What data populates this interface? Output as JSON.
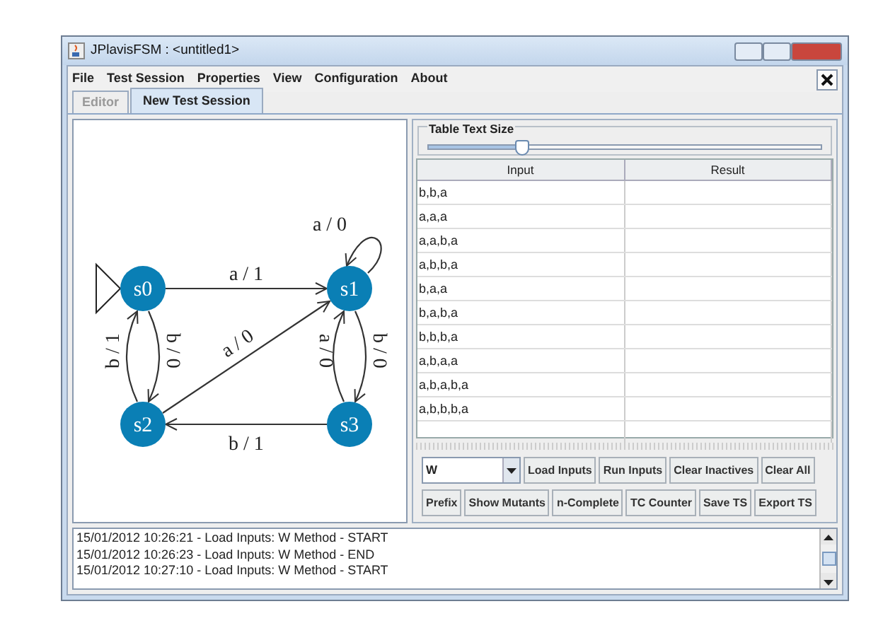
{
  "window": {
    "title": "JPlavisFSM : <untitled1>"
  },
  "menu": [
    "File",
    "Test Session",
    "Properties",
    "View",
    "Configuration",
    "About"
  ],
  "tabs": [
    {
      "label": "Editor",
      "selected": false
    },
    {
      "label": "New Test Session",
      "selected": true
    }
  ],
  "fsm": {
    "states": [
      {
        "name": "s0",
        "initial": true
      },
      {
        "name": "s1",
        "initial": false
      },
      {
        "name": "s2",
        "initial": false
      },
      {
        "name": "s3",
        "initial": false
      }
    ],
    "transitions": [
      {
        "label": "a / 1"
      },
      {
        "label": "a / 0"
      },
      {
        "label": "b / 0"
      },
      {
        "label": "b / 1"
      },
      {
        "label": "a / 0"
      },
      {
        "label": "b / 0"
      },
      {
        "label": "a / 0"
      },
      {
        "label": "b / 1"
      }
    ]
  },
  "table_text_size": {
    "label": "Table Text Size",
    "level": 0.24
  },
  "table": {
    "columns": [
      "Input",
      "Result"
    ],
    "rows": [
      {
        "input": "b,b,a"
      },
      {
        "input": "a,a,a"
      },
      {
        "input": "a,a,b,a"
      },
      {
        "input": "a,b,b,a"
      },
      {
        "input": "b,a,a"
      },
      {
        "input": "b,a,b,a"
      },
      {
        "input": "b,b,b,a"
      },
      {
        "input": "a,b,a,a"
      },
      {
        "input": "a,b,a,b,a"
      },
      {
        "input": "a,b,b,b,a"
      }
    ]
  },
  "method_select": {
    "value": "W"
  },
  "buttons_row1": [
    "Load Inputs",
    "Run Inputs",
    "Clear Inactives",
    "Clear All"
  ],
  "buttons_row2": [
    "Prefix",
    "Show Mutants",
    "n-Complete",
    "TC Counter",
    "Save TS",
    "Export TS"
  ],
  "log": [
    "15/01/2012 10:26:21 - Load Inputs: W Method - START",
    "15/01/2012 10:26:23 - Load Inputs: W Method - END",
    "15/01/2012 10:27:10 - Load Inputs: W Method - START"
  ]
}
